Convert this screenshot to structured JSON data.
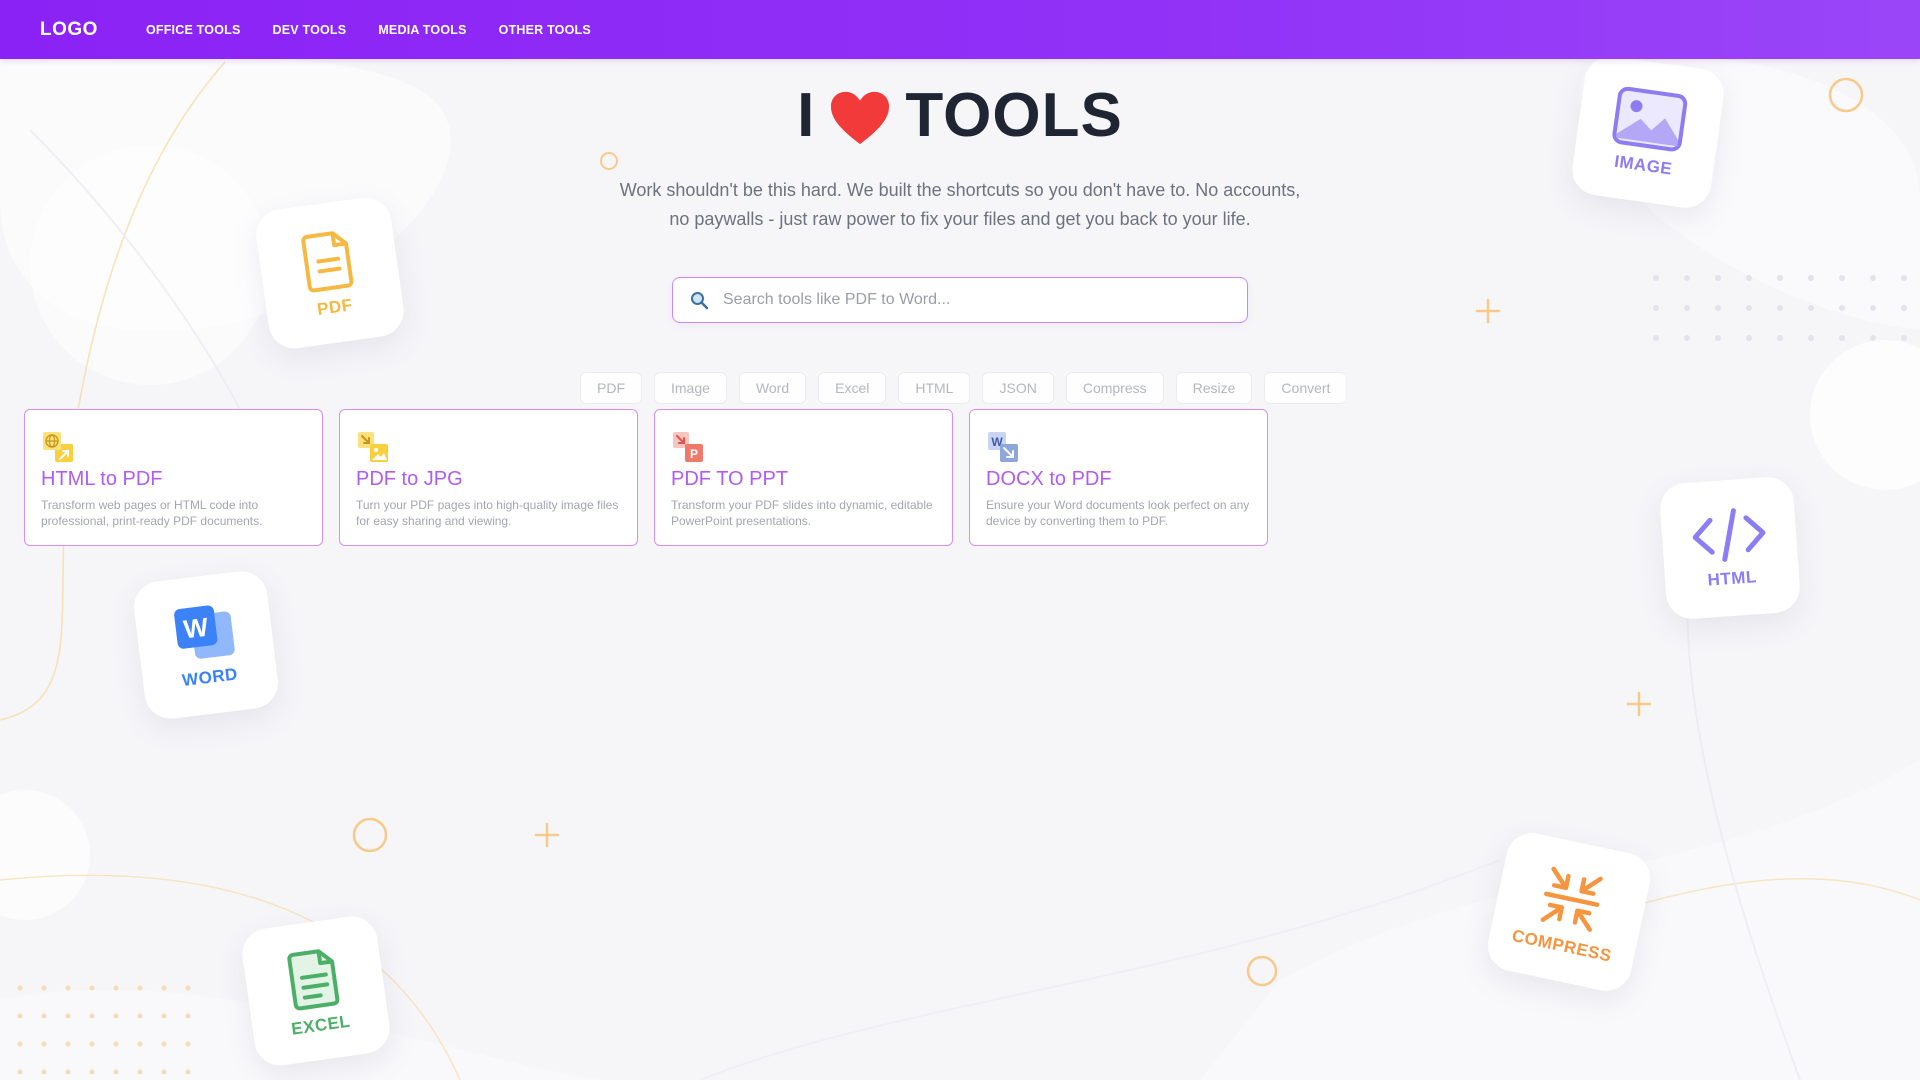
{
  "nav": {
    "logo": "LOGO",
    "links": [
      "OFFICE TOOLS",
      "DEV TOOLS",
      "MEDIA TOOLS",
      "OTHER TOOLS"
    ]
  },
  "hero": {
    "title_left": "I",
    "title_right": "TOOLS",
    "heart_icon": "heart-icon",
    "subtitle": "Work shouldn't be this hard. We built the shortcuts so you don't have to. No accounts, no paywalls - just raw power to fix your files and get you back to your life."
  },
  "search": {
    "placeholder": "Search tools like PDF to Word...",
    "value": "",
    "icon": "search-icon"
  },
  "chips": [
    "PDF",
    "Image",
    "Word",
    "Excel",
    "HTML",
    "JSON",
    "Compress",
    "Resize",
    "Convert"
  ],
  "cards": [
    {
      "title": "HTML to PDF",
      "description": "Transform web pages or HTML code into professional, print-ready PDF documents.",
      "icon": "html-to-pdf-icon"
    },
    {
      "title": "PDF to JPG",
      "description": "Turn your PDF pages into high-quality image files for easy sharing and viewing.",
      "icon": "pdf-to-jpg-icon"
    },
    {
      "title": "PDF TO PPT",
      "description": "Transform your PDF slides into dynamic, editable PowerPoint presentations.",
      "icon": "pdf-to-ppt-icon"
    },
    {
      "title": "DOCX to PDF",
      "description": "Ensure your Word documents look perfect on any device by converting them to PDF.",
      "icon": "docx-to-pdf-icon"
    }
  ],
  "decor_tiles": [
    {
      "label": "PDF",
      "icon": "pdf-icon",
      "color": "#f5b942"
    },
    {
      "label": "IMAGE",
      "icon": "image-icon",
      "color": "#8e7cf0"
    },
    {
      "label": "HTML",
      "icon": "code-icon",
      "color": "#8b7ef2"
    },
    {
      "label": "WORD",
      "icon": "word-icon",
      "color": "#3b82f6"
    },
    {
      "label": "EXCEL",
      "icon": "excel-icon",
      "color": "#4caf68"
    },
    {
      "label": "COMPRESS",
      "icon": "compress-icon",
      "color": "#f59540"
    }
  ],
  "colors": {
    "nav_start": "#8b22f5",
    "nav_end": "#9a46f8",
    "accent": "#b15cf0",
    "heart": "#f23a3a",
    "title": "#1f2533"
  }
}
